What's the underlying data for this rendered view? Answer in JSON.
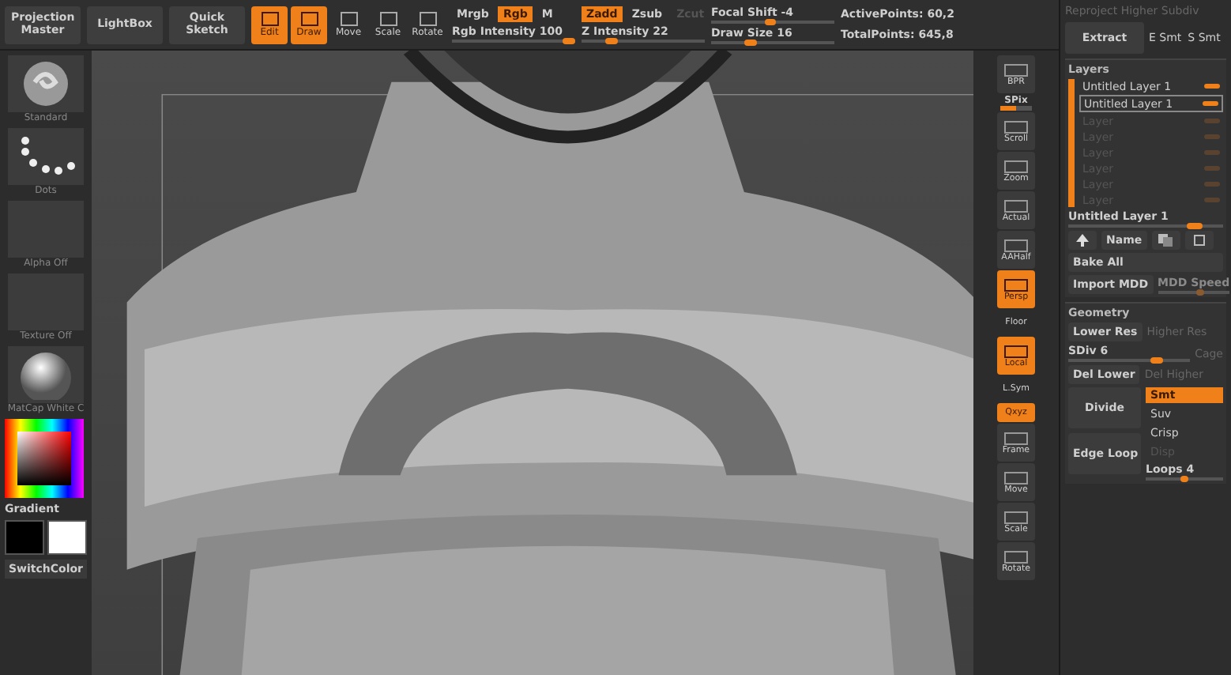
{
  "toolbar": {
    "buttons": [
      {
        "label": "Projection Master"
      },
      {
        "label": "LightBox"
      },
      {
        "label": "Quick Sketch"
      }
    ],
    "tools": [
      {
        "label": "Edit",
        "selected": true
      },
      {
        "label": "Draw",
        "selected": true
      },
      {
        "label": "Move",
        "selected": false
      },
      {
        "label": "Scale",
        "selected": false
      },
      {
        "label": "Rotate",
        "selected": false
      }
    ],
    "color_modes": [
      {
        "label": "Mrgb",
        "selected": false
      },
      {
        "label": "Rgb",
        "selected": true
      },
      {
        "label": "M",
        "selected": false
      }
    ],
    "rgb_intensity": {
      "label": "Rgb Intensity 100",
      "level": 1.0
    },
    "z_modes": [
      {
        "label": "Zadd",
        "selected": true,
        "disabled": false
      },
      {
        "label": "Zsub",
        "selected": false,
        "disabled": false
      },
      {
        "label": "Zcut",
        "selected": false,
        "disabled": true
      }
    ],
    "z_intensity": {
      "label": "Z Intensity 22",
      "level": 0.22
    },
    "focal_shift": {
      "label": "Focal Shift -4",
      "level": 0.48
    },
    "draw_size": {
      "label": "Draw Size 16",
      "level": 0.3
    },
    "stats": [
      "ActivePoints: 60,2",
      "TotalPoints: 645,8"
    ]
  },
  "shelf": {
    "items": [
      {
        "label": "Standard",
        "kind": "brush"
      },
      {
        "label": "Dots",
        "kind": "stroke"
      },
      {
        "label": "Alpha Off",
        "kind": "empty"
      },
      {
        "label": "Texture Off",
        "kind": "empty"
      },
      {
        "label": "MatCap White C",
        "kind": "material"
      }
    ],
    "gradient": "Gradient",
    "switch_color": "SwitchColor"
  },
  "view_tools": [
    {
      "label": "BPR",
      "selected": false,
      "kind": "button"
    },
    {
      "label": "SPix",
      "kind": "slider",
      "level": 0.5
    },
    {
      "label": "Scroll",
      "selected": false,
      "kind": "button"
    },
    {
      "label": "Zoom",
      "selected": false,
      "kind": "button"
    },
    {
      "label": "Actual",
      "selected": false,
      "kind": "button"
    },
    {
      "label": "AAHalf",
      "selected": false,
      "kind": "button"
    },
    {
      "label": "Persp",
      "selected": true,
      "kind": "button"
    },
    {
      "label": "Floor",
      "selected": false,
      "kind": "plain"
    },
    {
      "label": "Local",
      "selected": true,
      "kind": "button"
    },
    {
      "label": "L.Sym",
      "selected": false,
      "kind": "plain"
    },
    {
      "label": "Qxyz",
      "selected": true,
      "kind": "small"
    },
    {
      "label": "Frame",
      "selected": false,
      "kind": "button"
    },
    {
      "label": "Move",
      "selected": false,
      "kind": "button"
    },
    {
      "label": "Scale",
      "selected": false,
      "kind": "button"
    },
    {
      "label": "Rotate",
      "selected": false,
      "kind": "button"
    }
  ],
  "palette": {
    "reproject": "Reproject Higher Subdiv",
    "extract": "Extract",
    "smooth_labels": [
      "E Smt",
      "S Smt"
    ],
    "layers": {
      "title": "Layers",
      "items": [
        {
          "name": "Untitled Layer 1",
          "selected": false,
          "disabled": false
        },
        {
          "name": "Untitled Layer 1",
          "selected": true,
          "disabled": false
        },
        {
          "name": "Layer",
          "selected": false,
          "disabled": true
        },
        {
          "name": "Layer",
          "selected": false,
          "disabled": true
        },
        {
          "name": "Layer",
          "selected": false,
          "disabled": true
        },
        {
          "name": "Layer",
          "selected": false,
          "disabled": true
        },
        {
          "name": "Layer",
          "selected": false,
          "disabled": true
        },
        {
          "name": "Layer",
          "selected": false,
          "disabled": true
        }
      ],
      "current": {
        "label": "Untitled Layer 1",
        "level": 0.85
      },
      "name_button": "Name",
      "bake_all": "Bake All",
      "import_mdd": "Import MDD",
      "mdd_speed": {
        "label": "MDD Speed",
        "level": 0.6,
        "disabled": true
      }
    },
    "geometry": {
      "title": "Geometry",
      "lower_res": "Lower Res",
      "higher_res": "Higher Res",
      "sdiv": {
        "label": "SDiv 6",
        "level": 0.75
      },
      "cage": "Cage",
      "del_lower": "Del Lower",
      "del_higher": "Del Higher",
      "divide": "Divide",
      "edge_loop": "Edge Loop",
      "divide_options": [
        {
          "label": "Smt",
          "selected": true,
          "disabled": false
        },
        {
          "label": "Suv",
          "selected": false,
          "disabled": false
        },
        {
          "label": "Crisp",
          "selected": false,
          "disabled": false
        },
        {
          "label": "Disp",
          "selected": false,
          "disabled": true
        }
      ],
      "loops": {
        "label": "Loops 4",
        "level": 0.5
      }
    }
  }
}
